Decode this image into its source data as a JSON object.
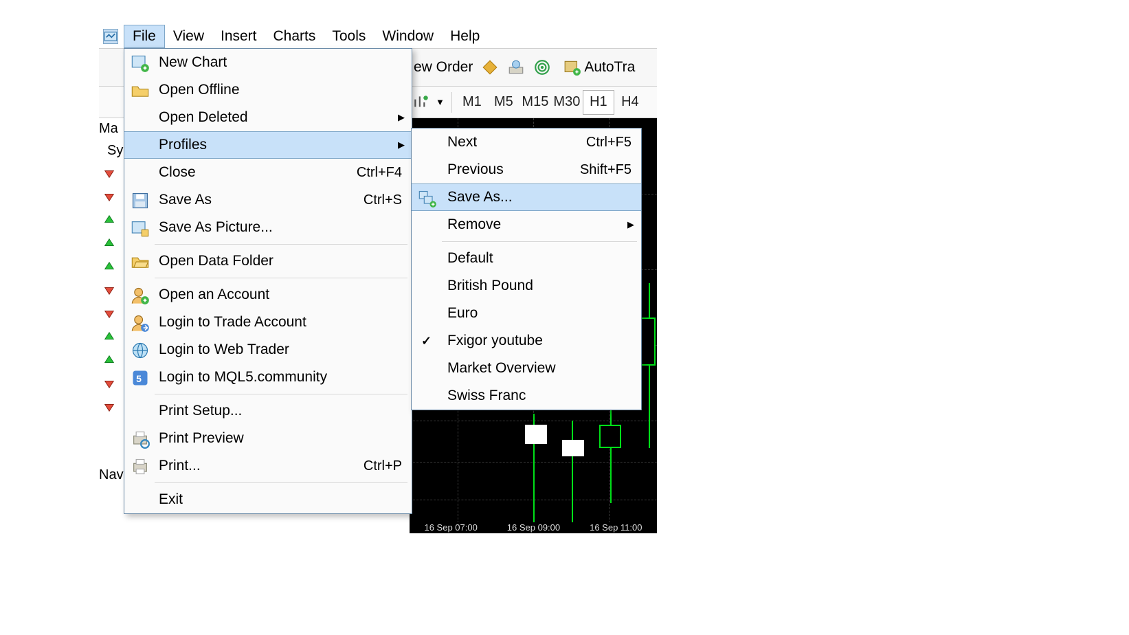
{
  "menubar": {
    "file": "File",
    "view": "View",
    "insert": "Insert",
    "charts": "Charts",
    "tools": "Tools",
    "window": "Window",
    "help": "Help"
  },
  "toolbar": {
    "new_order_visible": "ew Order",
    "autotrade_visible": "AutoTra"
  },
  "timeframes": {
    "m1": "M1",
    "m5": "M5",
    "m15": "M15",
    "m30": "M30",
    "h1": "H1",
    "h4": "H4",
    "active": "H1"
  },
  "left_panel": {
    "market_watch": "Ma",
    "symbol": "Sy",
    "navigator": "Nav",
    "arrow_dirs": [
      "down",
      "down",
      "up",
      "up",
      "up",
      "down",
      "down",
      "up",
      "up",
      "down",
      "down"
    ]
  },
  "file_menu": {
    "new_chart": "New Chart",
    "open_offline": "Open Offline",
    "open_deleted": "Open Deleted",
    "profiles": "Profiles",
    "close": "Close",
    "close_sc": "Ctrl+F4",
    "save_as": "Save As",
    "save_as_sc": "Ctrl+S",
    "save_as_picture": "Save As Picture...",
    "open_data_folder": "Open Data Folder",
    "open_account": "Open an Account",
    "login_trade": "Login to Trade Account",
    "login_web": "Login to Web Trader",
    "login_mql5": "Login to MQL5.community",
    "print_setup": "Print Setup...",
    "print_preview": "Print Preview",
    "print": "Print...",
    "print_sc": "Ctrl+P",
    "exit": "Exit"
  },
  "profiles_menu": {
    "next": "Next",
    "next_sc": "Ctrl+F5",
    "previous": "Previous",
    "previous_sc": "Shift+F5",
    "save_as": "Save As...",
    "remove": "Remove",
    "default": "Default",
    "british_pound": "British Pound",
    "euro": "Euro",
    "fxigor": "Fxigor youtube",
    "market_overview": "Market Overview",
    "swiss_franc": "Swiss Franc",
    "checked": "fxigor"
  },
  "chart": {
    "top_scale": "",
    "xaxis": [
      "16 Sep 07:00",
      "16 Sep 09:00",
      "16 Sep 11:00"
    ]
  }
}
